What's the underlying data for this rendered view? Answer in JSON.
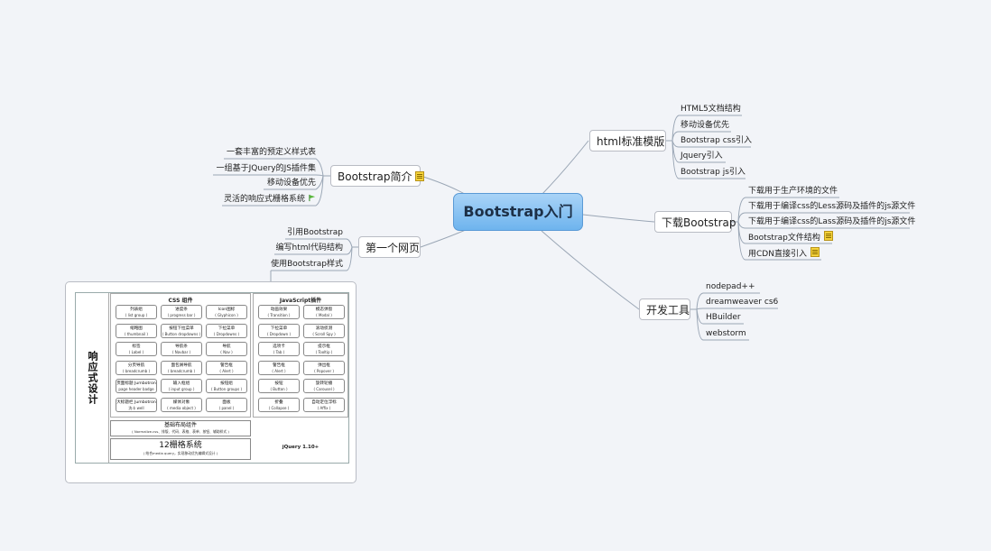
{
  "root": {
    "label": "Bootstrap入门"
  },
  "branches": {
    "intro": {
      "label": "Bootstrap简介",
      "items": [
        "一套丰富的预定义样式表",
        "一组基于JQuery的JS插件集",
        "移动设备优先",
        "灵活的响应式栅格系统"
      ]
    },
    "template": {
      "label": "html标准模版",
      "items": [
        "HTML5文档结构",
        "移动设备优先",
        "Bootstrap css引入",
        "Jquery引入",
        "Bootstrap js引入"
      ]
    },
    "download": {
      "label": "下载Bootstrap",
      "items": [
        "下载用于生产环境的文件",
        "下载用于编译css的Less源码及插件的js源文件",
        "下载用于编译css的Lass源码及插件的js源文件",
        "Bootstrap文件结构",
        "用CDN直接引入"
      ]
    },
    "first_page": {
      "label": "第一个网页",
      "items": [
        "引用Bootstrap",
        "编写html代码结构",
        "使用Bootstrap样式"
      ]
    },
    "tools": {
      "label": "开发工具",
      "items": [
        "nodepad++",
        "dreamweaver cs6",
        "HBuilder",
        "webstorm"
      ]
    }
  },
  "icons": {
    "intro_branch": "note-icon",
    "intro_grid_item": "flag-icon",
    "download_structure": "note-icon",
    "download_cdn": "note-icon"
  },
  "embedded_image": {
    "side_title": "响应式设计",
    "css_title": "CSS 组件",
    "js_title": "JavaScript插件",
    "css_cells": [
      [
        "列表组",
        "( list group )"
      ],
      [
        "进度条",
        "( progress bar )"
      ],
      [
        "Icon图标",
        "( Glyphicon )"
      ],
      [
        "缩略图",
        "( thumbnail )"
      ],
      [
        "按钮下拉菜单",
        "( Button dropdowns )"
      ],
      [
        "下拉菜单",
        "( Dropdowns )"
      ],
      [
        "标签",
        "( Label )"
      ],
      [
        "导航条",
        "( Navbar )"
      ],
      [
        "导航",
        "( Nav )"
      ],
      [
        "分页导航",
        "( breadcrumb )"
      ],
      [
        "面包屑导航",
        "( breadcrumb )"
      ],
      [
        "警告框",
        "( Alert )"
      ],
      [
        "页面标题 Jumbotron",
        "page header badge"
      ],
      [
        "输入框组",
        "( input group )"
      ],
      [
        "按钮组",
        "( Button groups )"
      ],
      [
        "大标题栏 Jumbotron",
        "洗卡 well"
      ],
      [
        "媒体对象",
        "( media object )"
      ],
      [
        "面板",
        "( panel )"
      ]
    ],
    "js_cells": [
      [
        "动画效果",
        "( Transition )"
      ],
      [
        "模态弹窗",
        "( Modal )"
      ],
      [
        "下拉菜单",
        "( Dropdown )"
      ],
      [
        "滚动侦测",
        "( Scroll Spy )"
      ],
      [
        "选项卡",
        "( Tab )"
      ],
      [
        "提示框",
        "( Tooltip )"
      ],
      [
        "警告框",
        "( Alert )"
      ],
      [
        "弹出框",
        "( Popover )"
      ],
      [
        "按钮",
        "( Button )"
      ],
      [
        "旋转轮播",
        "( Carousel )"
      ],
      [
        "折叠",
        "( Collapse )"
      ],
      [
        "自动定位浮标",
        "( Affix )"
      ]
    ],
    "base_layout": {
      "title": "基础布局组件",
      "sub": "( Normalize.css、排版、代码、表格、表单、按钮、辅助样式 )"
    },
    "grid": {
      "title": "12栅格系统",
      "sub": "( 结合media query，实现移动优先编辑式设计 )"
    },
    "jquery": "jQuery 1.10+"
  },
  "colors": {
    "background": "#f2f4f8",
    "root_fill": "#7dbdf2",
    "connector": "#9aa6b5",
    "branch_border": "#b9bcc4"
  }
}
